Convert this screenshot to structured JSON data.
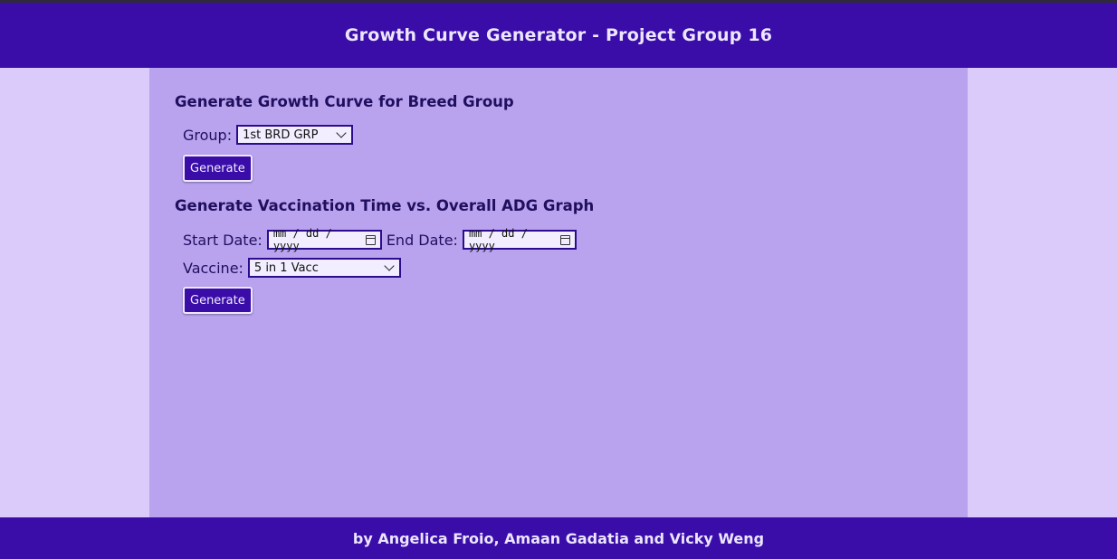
{
  "header": {
    "title": "Growth Curve Generator - Project Group 16"
  },
  "growth_section": {
    "title": "Generate Growth Curve for Breed Group",
    "group_label": "Group:",
    "group_selected": "1st BRD GRP",
    "button_label": "Generate"
  },
  "vaccination_section": {
    "title": "Generate Vaccination Time vs. Overall ADG Graph",
    "start_label": "Start Date:",
    "start_value": "mm / dd / yyyy",
    "end_label": "End Date:",
    "end_value": "mm / dd / yyyy",
    "vaccine_label": "Vaccine:",
    "vaccine_selected": "5 in 1 Vacc",
    "button_label": "Generate"
  },
  "footer": {
    "text": "by Angelica Froio, Amaan Gadatia and Vicky Weng"
  },
  "colors": {
    "primary": "#3a0ca8",
    "panel": "#b9a3ef",
    "sidebar": "#dacbfb"
  },
  "icons": [
    "chevron-down-icon",
    "calendar-icon"
  ]
}
